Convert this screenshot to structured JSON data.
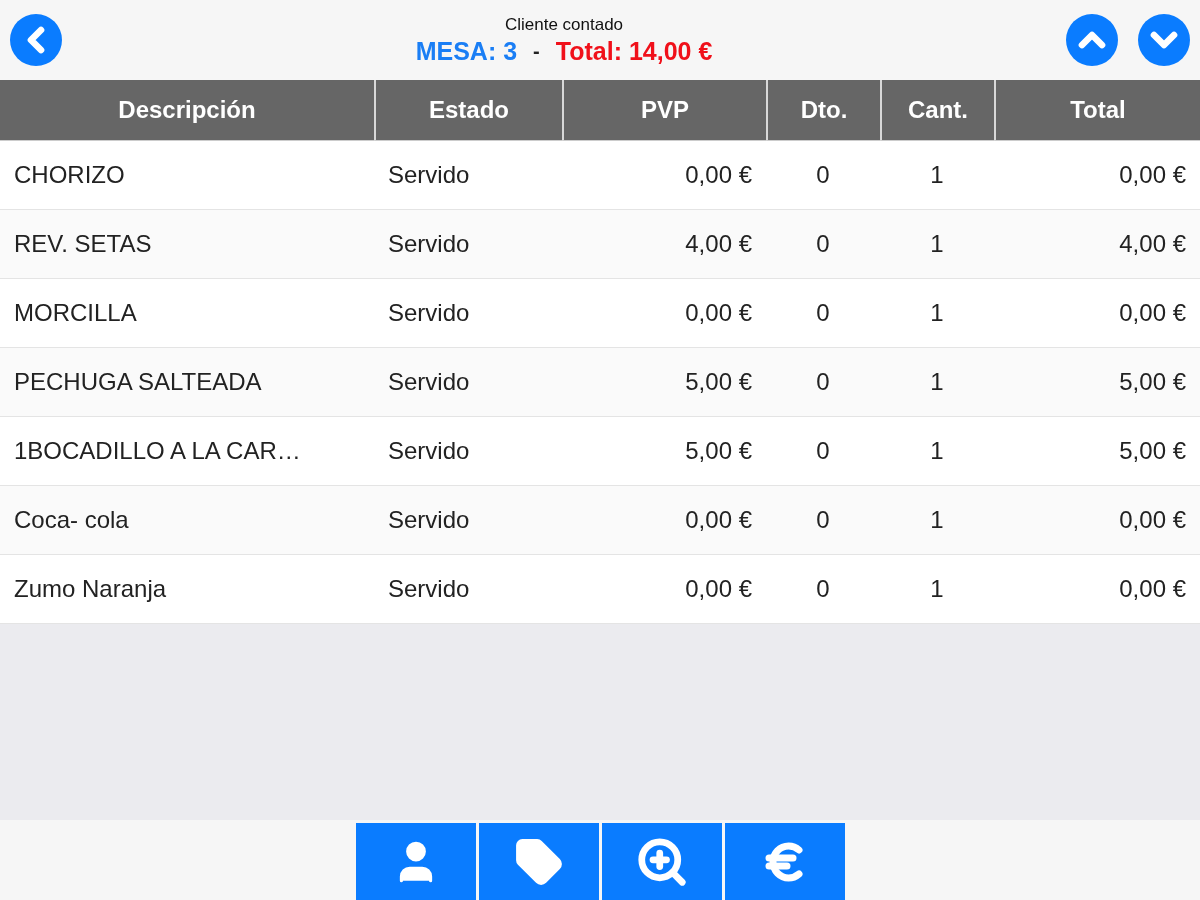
{
  "header": {
    "customer": "Cliente contado",
    "table_label": "MESA: 3",
    "separator": "-",
    "total_label": "Total: 14,00 €"
  },
  "table": {
    "columns": [
      "Descripción",
      "Estado",
      "PVP",
      "Dto.",
      "Cant.",
      "Total"
    ],
    "rows": [
      [
        "CHORIZO",
        "Servido",
        "0,00 €",
        "0",
        "1",
        "0,00 €"
      ],
      [
        "REV. SETAS",
        "Servido",
        "4,00 €",
        "0",
        "1",
        "4,00 €"
      ],
      [
        "MORCILLA",
        "Servido",
        "0,00 €",
        "0",
        "1",
        "0,00 €"
      ],
      [
        "PECHUGA SALTEADA",
        "Servido",
        "5,00 €",
        "0",
        "1",
        "5,00 €"
      ],
      [
        "1BOCADILLO A LA CAR…",
        "Servido",
        "5,00 €",
        "0",
        "1",
        "5,00 €"
      ],
      [
        "Coca- cola",
        "Servido",
        "0,00 €",
        "0",
        "1",
        "0,00 €"
      ],
      [
        "Zumo Naranja",
        "Servido",
        "0,00 €",
        "0",
        "1",
        "0,00 €"
      ]
    ]
  },
  "toolbar": [
    {
      "kind": "customer"
    },
    {
      "kind": "tag"
    },
    {
      "kind": "zoom"
    },
    {
      "kind": "pay"
    }
  ]
}
